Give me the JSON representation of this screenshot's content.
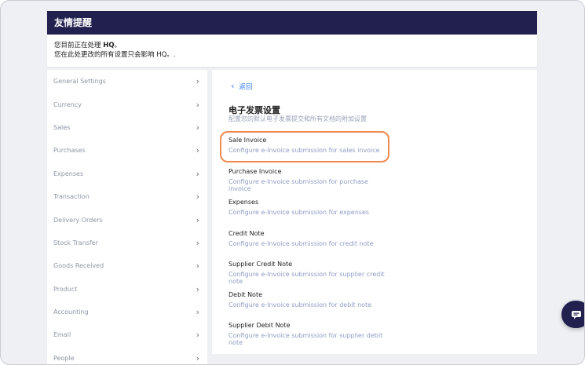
{
  "alert": {
    "title": "友情提醒",
    "line1_prefix": "您目前正在处理 ",
    "line1_strong": "HQ",
    "line1_suffix": "。",
    "line2": "您在此处更改的所有设置只会影响 HQ。."
  },
  "sidebar": {
    "items": [
      {
        "label": "General Settings"
      },
      {
        "label": "Currency"
      },
      {
        "label": "Sales"
      },
      {
        "label": "Purchases"
      },
      {
        "label": "Expenses"
      },
      {
        "label": "Transaction"
      },
      {
        "label": "Delivery Orders"
      },
      {
        "label": "Stock Transfer"
      },
      {
        "label": "Goods Received"
      },
      {
        "label": "Product"
      },
      {
        "label": "Accounting"
      },
      {
        "label": "Email"
      },
      {
        "label": "People"
      }
    ],
    "chevron": "›"
  },
  "main": {
    "back_label": "返回",
    "back_icon": "‹",
    "title": "电子发票设置",
    "subtitle": "配置您的默认电子发票提交和所有文档的附加设置",
    "options": [
      {
        "title": "Sale Invoice",
        "desc": "Configure e-Invoice submission for sales invoice"
      },
      {
        "title": "Purchase Invoice",
        "desc": "Configure e-Invoice submission for purchase invoice"
      },
      {
        "title": "Expenses",
        "desc": "Configure e-Invoice submission for expenses"
      },
      {
        "title": "Credit Note",
        "desc": "Configure e-Invoice submission for credit note"
      },
      {
        "title": "Supplier Credit Note",
        "desc": "Configure e-Invoice submission for supplier credit note"
      },
      {
        "title": "Debit Note",
        "desc": "Configure e-Invoice submission for debit note"
      },
      {
        "title": "Supplier Debit Note",
        "desc": "Configure e-Invoice submission for supplier debit note"
      }
    ]
  },
  "colors": {
    "header_bg": "#21204f",
    "highlight": "#f08a4e",
    "link": "#3b82f6"
  }
}
